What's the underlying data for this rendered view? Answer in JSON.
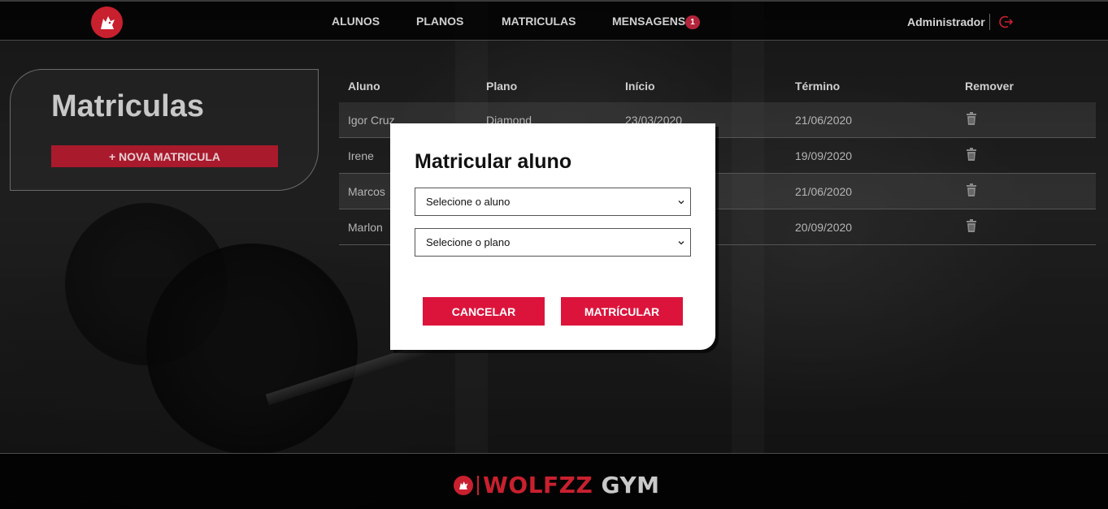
{
  "nav": {
    "items": [
      {
        "label": "ALUNOS"
      },
      {
        "label": "PLANOS"
      },
      {
        "label": "MATRICULAS"
      },
      {
        "label": "MENSAGENS",
        "badge": "1"
      }
    ],
    "user": "Administrador"
  },
  "sidebar": {
    "title": "Matriculas",
    "new_button": "+ NOVA MATRICULA"
  },
  "table": {
    "headers": [
      "Aluno",
      "Plano",
      "Início",
      "Término",
      "Remover"
    ],
    "rows": [
      {
        "aluno": "Igor Cruz",
        "plano": "Diamond",
        "inicio": "23/03/2020",
        "termino": "21/06/2020"
      },
      {
        "aluno": "Irene",
        "plano": "",
        "inicio": "",
        "termino": "19/09/2020"
      },
      {
        "aluno": "Marcos",
        "plano": "",
        "inicio": "",
        "termino": "21/06/2020"
      },
      {
        "aluno": "Marlon",
        "plano": "",
        "inicio": "",
        "termino": "20/09/2020"
      }
    ]
  },
  "modal": {
    "title": "Matricular aluno",
    "select_aluno": "Selecione o aluno",
    "select_plano": "Selecione o plano",
    "cancel": "CANCELAR",
    "confirm": "MATRÍCULAR"
  },
  "footer": {
    "brand_a": "WOLFZZ",
    "brand_b": "GYM"
  },
  "colors": {
    "accent": "#dc143c",
    "brand_red": "#c8202e"
  }
}
